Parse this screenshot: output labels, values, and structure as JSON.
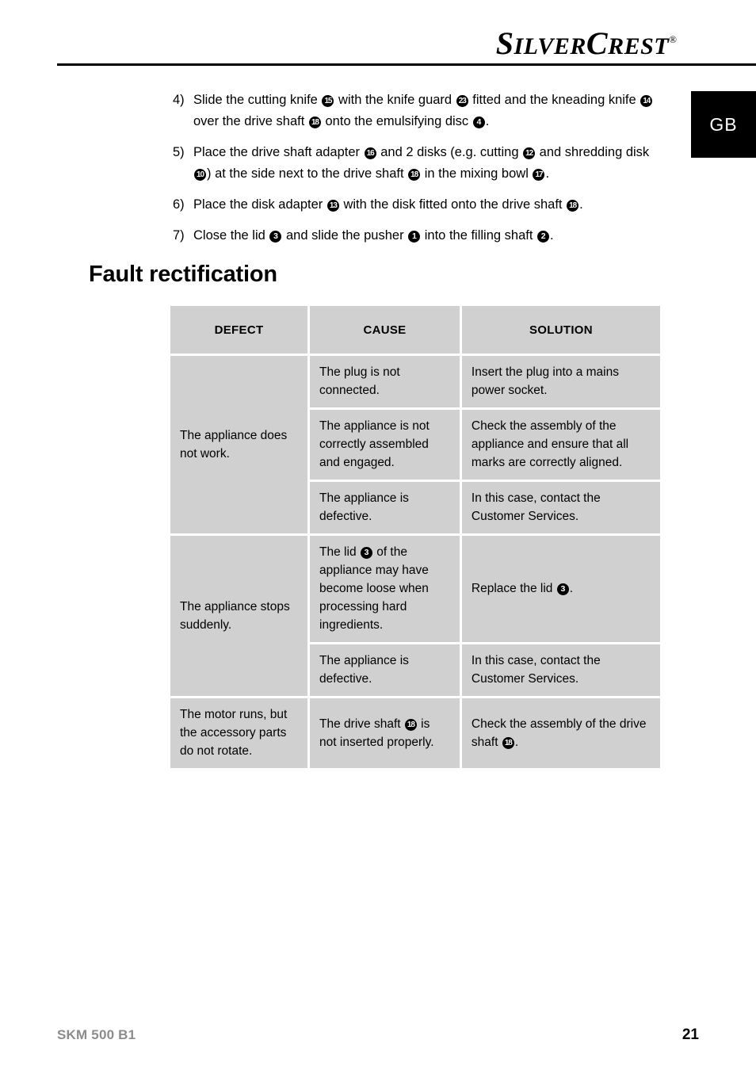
{
  "header": {
    "brand_part1": "S",
    "brand_part1_rest": "ILVER",
    "brand_part2": "C",
    "brand_part2_rest": "REST",
    "registered_mark": "®",
    "language_tab": "GB"
  },
  "steps": [
    {
      "number": "4)",
      "segments": [
        {
          "type": "text",
          "value": "Slide the cutting knife "
        },
        {
          "type": "ref",
          "value": "15"
        },
        {
          "type": "text",
          "value": " with the knife guard "
        },
        {
          "type": "ref",
          "value": "23"
        },
        {
          "type": "text",
          "value": " fitted and the kneading knife "
        },
        {
          "type": "ref",
          "value": "14"
        },
        {
          "type": "text",
          "value": " over the drive shaft "
        },
        {
          "type": "ref",
          "value": "18"
        },
        {
          "type": "text",
          "value": " onto the emulsifying disc "
        },
        {
          "type": "ref",
          "value": "4"
        },
        {
          "type": "text",
          "value": "."
        }
      ]
    },
    {
      "number": "5)",
      "segments": [
        {
          "type": "text",
          "value": "Place the drive shaft adapter "
        },
        {
          "type": "ref",
          "value": "16"
        },
        {
          "type": "text",
          "value": " and 2 disks (e.g. cutting "
        },
        {
          "type": "ref",
          "value": "12"
        },
        {
          "type": "text",
          "value": " and shredding disk "
        },
        {
          "type": "ref",
          "value": "10"
        },
        {
          "type": "text",
          "value": ") at the side next to the drive shaft "
        },
        {
          "type": "ref",
          "value": "18"
        },
        {
          "type": "text",
          "value": " in the mixing bowl "
        },
        {
          "type": "ref",
          "value": "17"
        },
        {
          "type": "text",
          "value": "."
        }
      ]
    },
    {
      "number": "6)",
      "segments": [
        {
          "type": "text",
          "value": "Place the disk adapter "
        },
        {
          "type": "ref",
          "value": "13"
        },
        {
          "type": "text",
          "value": " with the disk fitted onto the drive shaft "
        },
        {
          "type": "ref",
          "value": "18"
        },
        {
          "type": "text",
          "value": "."
        }
      ]
    },
    {
      "number": "7)",
      "segments": [
        {
          "type": "text",
          "value": "Close the lid "
        },
        {
          "type": "ref",
          "value": "3"
        },
        {
          "type": "text",
          "value": " and slide the pusher "
        },
        {
          "type": "ref",
          "value": "1"
        },
        {
          "type": "text",
          "value": " into the filling shaft "
        },
        {
          "type": "ref",
          "value": "2"
        },
        {
          "type": "text",
          "value": "."
        }
      ]
    }
  ],
  "section": {
    "heading": "Fault rectification"
  },
  "table": {
    "headers": [
      "DEFECT",
      "CAUSE",
      "SOLUTION"
    ],
    "rows": [
      {
        "defect": "The appliance does not work.",
        "defect_rowspan": 3,
        "entries": [
          {
            "cause_segments": [
              {
                "type": "text",
                "value": "The plug is not connected."
              }
            ],
            "solution_segments": [
              {
                "type": "text",
                "value": "Insert the plug into a mains power socket."
              }
            ]
          },
          {
            "cause_segments": [
              {
                "type": "text",
                "value": "The appliance is not correctly assembled and engaged."
              }
            ],
            "solution_segments": [
              {
                "type": "text",
                "value": "Check the assembly of the appliance and ensure that all marks are correctly aligned."
              }
            ]
          },
          {
            "cause_segments": [
              {
                "type": "text",
                "value": "The appliance is defective."
              }
            ],
            "solution_segments": [
              {
                "type": "text",
                "value": "In this case, contact the Customer Services."
              }
            ]
          }
        ]
      },
      {
        "defect": "The appliance stops suddenly.",
        "defect_rowspan": 2,
        "entries": [
          {
            "cause_segments": [
              {
                "type": "text",
                "value": "The lid "
              },
              {
                "type": "ref",
                "value": "3"
              },
              {
                "type": "text",
                "value": " of the appliance may have become loose when processing hard ingredients."
              }
            ],
            "solution_segments": [
              {
                "type": "text",
                "value": "Replace the lid "
              },
              {
                "type": "ref",
                "value": "3"
              },
              {
                "type": "text",
                "value": "."
              }
            ]
          },
          {
            "cause_segments": [
              {
                "type": "text",
                "value": "The appliance is defective."
              }
            ],
            "solution_segments": [
              {
                "type": "text",
                "value": "In this case, contact the Customer Services."
              }
            ]
          }
        ]
      },
      {
        "defect": "The motor runs, but the accessory parts do not rotate.",
        "defect_rowspan": 1,
        "entries": [
          {
            "cause_segments": [
              {
                "type": "text",
                "value": "The drive shaft "
              },
              {
                "type": "ref",
                "value": "18"
              },
              {
                "type": "text",
                "value": " is not inserted properly."
              }
            ],
            "solution_segments": [
              {
                "type": "text",
                "value": "Check the assembly of the drive shaft "
              },
              {
                "type": "ref",
                "value": "18"
              },
              {
                "type": "text",
                "value": "."
              }
            ]
          }
        ]
      }
    ]
  },
  "footer": {
    "model": "SKM 500 B1",
    "page_number": "21"
  }
}
